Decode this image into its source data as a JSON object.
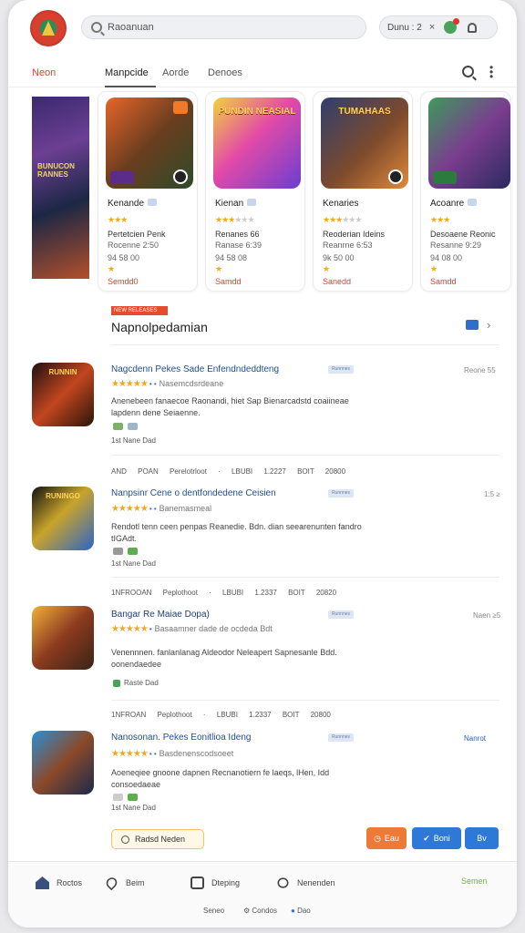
{
  "header": {
    "search_value": "Raoanuan",
    "user_label": "Dunu : 2",
    "close_glyph": "×"
  },
  "tabs": {
    "brand": "Neon",
    "items": [
      "Manpcide",
      "Aorde",
      "Denoes"
    ]
  },
  "carousel": {
    "banner_text": "BUNUCON RANNES",
    "cards": [
      {
        "art_text": "",
        "name": "Kenande",
        "stars_full": "★★★",
        "stars_rest": "",
        "line1": "Pertetcien Penk",
        "line2": "Rocenne 2:50",
        "line3": "94 58 00",
        "line4": "★",
        "price": "Semdd0"
      },
      {
        "art_text": "PUNDIN NEASIAL",
        "name": "Kienan",
        "stars_full": "★★★",
        "stars_rest": "★★★",
        "line1": "Renanes 66",
        "line2": "Ranase 6:39",
        "line3": "94 58 08",
        "line4": "★",
        "price": "Samdd"
      },
      {
        "art_text": "TUMAHAAS",
        "name": "Kenaries",
        "stars_full": "★★★",
        "stars_rest": "★★★",
        "line1": "Reoderian Ideins",
        "line2": "Reanrne 6:53",
        "line3": "9k 50 00",
        "line4": "★",
        "price": "Sanedd"
      },
      {
        "art_text": "",
        "name": "Acoanre",
        "stars_full": "★★★",
        "stars_rest": "",
        "line1": "Desoaene Reonic",
        "line2": "Resanne 9:29",
        "line3": "94 08 00",
        "line4": "★",
        "price": "Samdd"
      }
    ]
  },
  "section": {
    "badge": "NEW RELEASES",
    "title": "Napnolpedamian",
    "chevron": "›"
  },
  "list": [
    {
      "thumb_text": "RUNNIN",
      "title": "Nagcdenn Pekes Sade Enfendndeddteng",
      "chip": "Runnnes",
      "right": "Reone 55",
      "stars": "★★★★★",
      "dots": "• •",
      "dev": "Nasemcdsrdeane",
      "desc": "Anenebeen fanaecoe Raonandi, hiet Sap Bienarcadstd coaiineae lapdenn dene Seiaenne.",
      "meta": "1st  Nane  Dad",
      "stats": "AND POAN  Perelotrloot  ·  LBUBI  1.2227  BOIT  20800"
    },
    {
      "thumb_text": "RUNINGO",
      "title": "Nanpsinr Cene o dentfondedene Ceisien",
      "chip": "Runnnes",
      "right": "1:5 ≥",
      "stars": "★★★★★",
      "dots": "• •",
      "dev": "Banemasmeal",
      "desc": "Rendotl tenn ceen penpas Reanedie. Bdn. dian seearenunten fandro tIGAdt.",
      "meta": "1st  Nane  Dad",
      "stats": "1NFROOAN  Peplothoot  ·  LBUBI  1.2337  BOIT  20820"
    },
    {
      "thumb_text": "",
      "title": "Bangar Re Maiae Dopa)",
      "chip": "Runnnes",
      "right": "Naen ≥5",
      "stars": "★★★★★",
      "dots": "•",
      "dev": "Basaamner dade de ocdeda Bdt",
      "desc": "Venennnen. fanlanlanag Aldeodor Neleapert Sapnesanle Bdd. oonendaedee",
      "meta": "Raste  Dad",
      "stats": "1NFROAN  Peplothoot  ·  LBUBI  1.2337  BOIT  20800"
    },
    {
      "thumb_text": "",
      "title": "Nanosonan. Pekes Eonitlioa Ideng",
      "chip": "Runnnes",
      "right": "Nanrot",
      "stars": "★★★★★",
      "dots": "• •",
      "dev": "Basdenenscodsoeet",
      "desc": "Aoeneqiee gnoone dapnen Recnanotiern fe laeqs, lHen, Idd consoedaeae",
      "meta": "1st  Nane  Dad",
      "stats": ""
    }
  ],
  "actions": {
    "readmore": "Radsd Neden",
    "btn_orange": "Eau",
    "btn_blue1": "Boni",
    "btn_blue2": "Bv"
  },
  "footer": {
    "nav": [
      "Roctos",
      "Beim",
      "Dteping",
      "Nenenden"
    ],
    "green": "Semen",
    "sub": [
      "Seneo",
      "Condos",
      "Dao"
    ]
  },
  "colors": {
    "accent_red": "#d6452e",
    "link_blue": "#1d4d9a",
    "star": "#f2a81b",
    "green": "#74b53a"
  }
}
